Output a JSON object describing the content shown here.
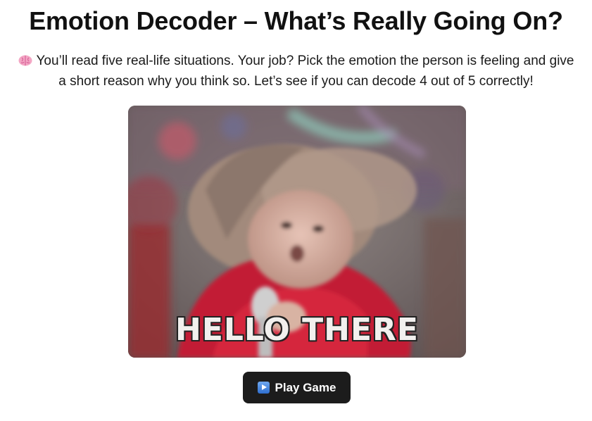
{
  "page": {
    "title": "Emotion Decoder – What’s Really Going On?",
    "intro_icon": "brain-icon",
    "intro_text": "You’ll read five real-life situations. Your job? Pick the emotion the person is feeling and give a short reason why you think so. Let’s see if you can decode 4 out of 5 correctly!"
  },
  "gif": {
    "caption": "HELLO THERE"
  },
  "actions": {
    "play_icon": "play-button-icon",
    "play_label": "Play Game"
  },
  "colors": {
    "button_bg": "#1c1c1c",
    "button_text": "#ffffff",
    "title_text": "#111111"
  }
}
